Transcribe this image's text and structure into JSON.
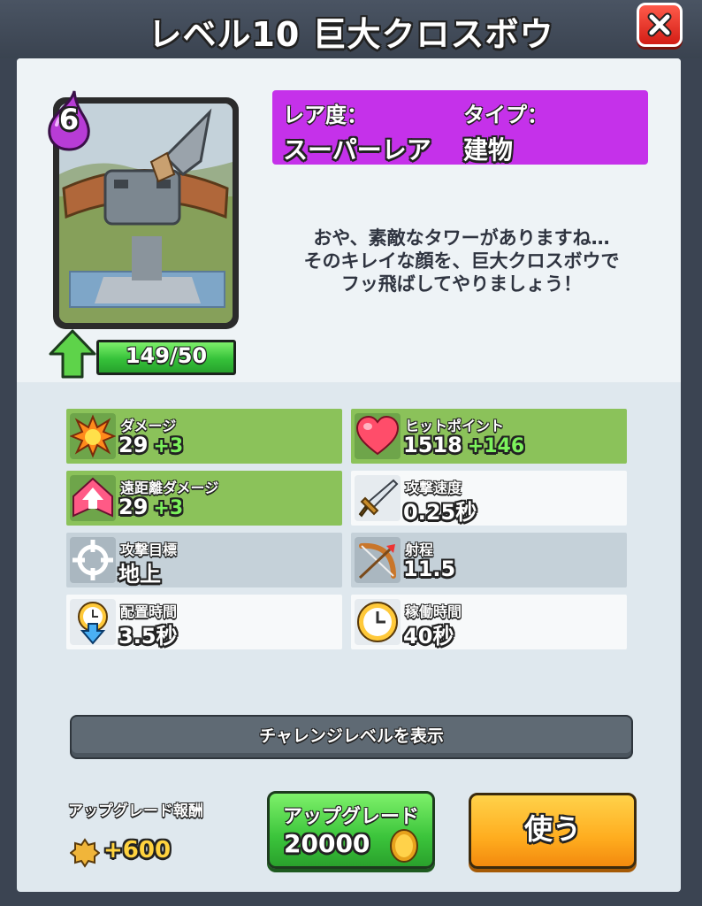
{
  "header": {
    "title": "レベル10 巨大クロスボウ",
    "close_icon": "close-x-icon"
  },
  "card": {
    "elixir_cost": "6",
    "card_count_text": "149/50",
    "progress_fraction": 1.0,
    "upgrade_arrow_icon": "up-arrow-icon"
  },
  "rarity": {
    "rarity_label": "レア度：",
    "rarity_value": "スーパーレア",
    "type_label": "タイプ：",
    "type_value": "建物"
  },
  "description": {
    "line1": "おや、素敵なタワーがありますね…",
    "line2": "そのキレイな顔を、巨大クロスボウで",
    "line3": "フッ飛ばしてやりましょう！"
  },
  "stats": [
    {
      "label": "ダメージ",
      "value": "29",
      "bonus": "+3",
      "icon": "explosion-icon"
    },
    {
      "label": "ヒットポイント",
      "value": "1518",
      "bonus": "+146",
      "icon": "heart-icon"
    },
    {
      "label": "遠距離ダメージ",
      "value": "29",
      "bonus": "+3",
      "icon": "ranged-arrow-icon"
    },
    {
      "label": "攻撃速度",
      "value": "0.25秒",
      "bonus": "",
      "icon": "sword-icon"
    },
    {
      "label": "攻撃目標",
      "value": "地上",
      "bonus": "",
      "icon": "crosshair-icon"
    },
    {
      "label": "射程",
      "value": "11.5",
      "bonus": "",
      "icon": "bow-icon"
    },
    {
      "label": "配置時間",
      "value": "3.5秒",
      "bonus": "",
      "icon": "deploy-clock-icon"
    },
    {
      "label": "稼働時間",
      "value": "40秒",
      "bonus": "",
      "icon": "clock-icon"
    }
  ],
  "buttons": {
    "challenge": "チャレンジレベルを表示",
    "upgrade_label": "アップグレード",
    "upgrade_cost": "20000",
    "use": "使う"
  },
  "reward": {
    "label": "アップグレード報酬",
    "value": "+600",
    "icon": "star-badge-icon"
  },
  "colors": {
    "rarity_bg": "#c531ea",
    "stat_upgrade_bg": "#8bc25a",
    "bonus_text": "#7cf25c",
    "upgrade_button": "#3bc43b",
    "use_button": "#ffad1f",
    "close_button": "#e12a20"
  }
}
